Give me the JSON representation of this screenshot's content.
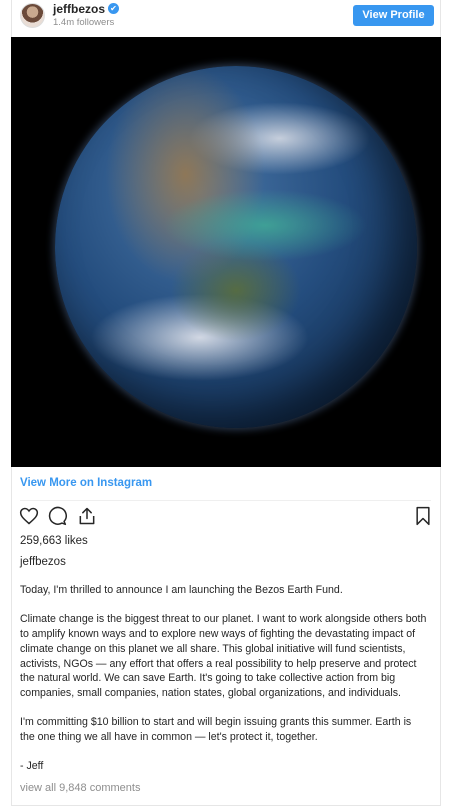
{
  "header": {
    "username": "jeffbezos",
    "verified_mark": "✔",
    "followers": "1.4m followers",
    "view_profile_label": "View Profile"
  },
  "view_more_label": "View More on Instagram",
  "actions": {
    "icons": [
      "heart-icon",
      "comment-icon",
      "share-icon",
      "bookmark-icon"
    ]
  },
  "likes": "259,663 likes",
  "author": "jeffbezos",
  "caption": {
    "p1": "Today, I'm thrilled to announce I am launching the Bezos Earth Fund.",
    "p2": "Climate change is the biggest threat to our planet. I want to work alongside others both to amplify known ways and to explore new ways of fighting the devastating impact of climate change on this planet we all share. This global initiative will fund scientists, activists, NGOs — any effort that offers a real possibility to help preserve and protect the natural world. We can save Earth. It's going to take collective action from big companies, small companies, nation states, global organizations, and individuals.",
    "p3": "I'm committing $10 billion to start and will begin issuing grants this summer. Earth is the one thing we all have in common — let's protect it, together.",
    "p4": "- Jeff"
  },
  "comments_link": "view all 9,848 comments",
  "colors": {
    "accent": "#3897f0",
    "text": "#262626",
    "muted": "#8e8e8e"
  }
}
